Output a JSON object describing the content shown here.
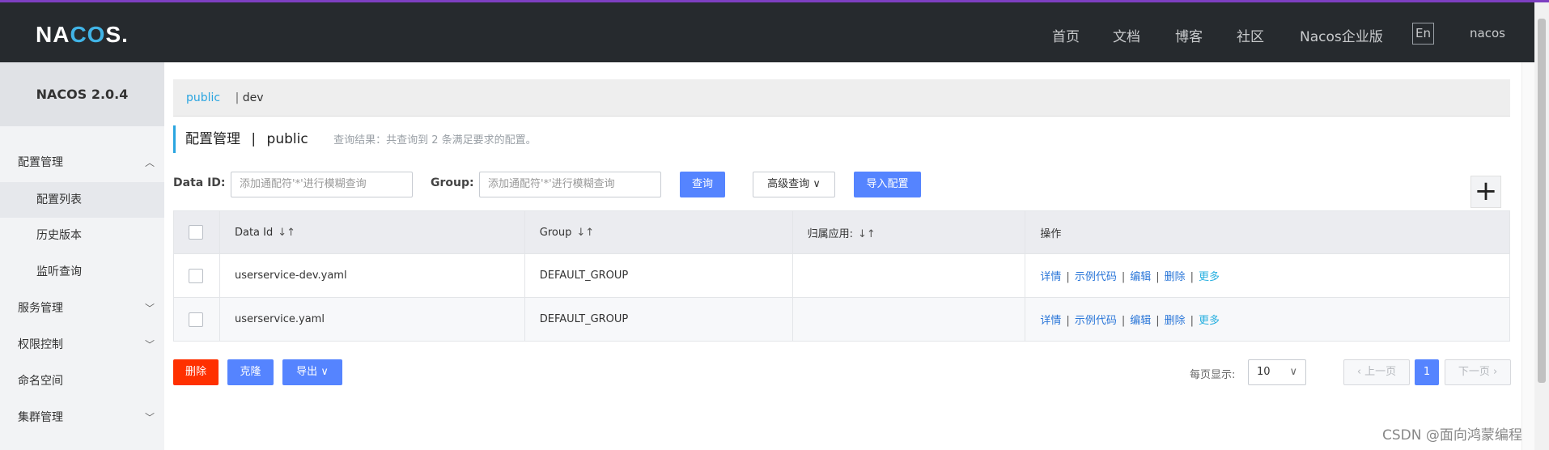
{
  "header": {
    "logo": "NACOS.",
    "nav": [
      "首页",
      "文档",
      "博客",
      "社区",
      "Nacos企业版"
    ],
    "lang": "En",
    "user": "nacos"
  },
  "sidebar": {
    "version": "NACOS 2.0.4",
    "items": [
      {
        "label": "配置管理",
        "chevron": "chevron-up-icon"
      },
      {
        "label": "配置列表"
      },
      {
        "label": "历史版本"
      },
      {
        "label": "监听查询"
      },
      {
        "label": "服务管理",
        "chevron": "chevron-down-icon"
      },
      {
        "label": "权限控制",
        "chevron": "chevron-down-icon"
      },
      {
        "label": "命名空间"
      },
      {
        "label": "集群管理",
        "chevron": "chevron-down-icon"
      }
    ]
  },
  "namespaces": {
    "current": "public",
    "other": "dev"
  },
  "page": {
    "title": "配置管理",
    "ns": "public",
    "hint": "查询结果：共查询到 2 条满足要求的配置。"
  },
  "search": {
    "dataid_label": "Data ID:",
    "dataid_placeholder": "添加通配符'*'进行模糊查询",
    "group_label": "Group:",
    "group_placeholder": "添加通配符'*'进行模糊查询",
    "query": "查询",
    "advanced": "高级查询",
    "import": "导入配置"
  },
  "table": {
    "columns": [
      "Data Id",
      "Group",
      "归属应用:",
      "操作"
    ],
    "rows": [
      {
        "dataid": "userservice-dev.yaml",
        "group": "DEFAULT_GROUP",
        "app": ""
      },
      {
        "dataid": "userservice.yaml",
        "group": "DEFAULT_GROUP",
        "app": ""
      }
    ],
    "actions": {
      "detail": "详情",
      "sample": "示例代码",
      "edit": "编辑",
      "delete": "删除",
      "more": "更多"
    }
  },
  "bulk": {
    "delete": "删除",
    "clone": "克隆",
    "export": "导出"
  },
  "pager": {
    "per_page_label": "每页显示:",
    "per_page": "10",
    "prev": "上一页",
    "current": "1",
    "next": "下一页"
  },
  "watermark": "CSDN @面向鸿蒙编程",
  "colors": {
    "accent": "#5584ff",
    "danger": "#ff3000",
    "link": "#2a76d8",
    "header_bg": "#262a2e"
  }
}
